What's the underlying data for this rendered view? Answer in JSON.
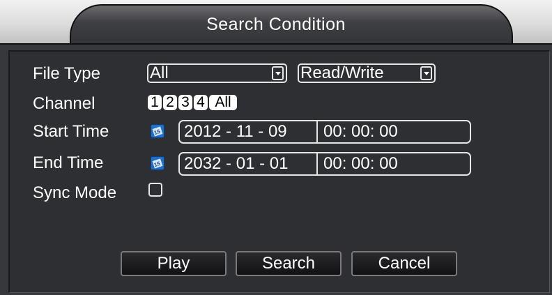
{
  "dialog": {
    "title": "Search Condition"
  },
  "form": {
    "file_type_label": "File Type",
    "file_type_value": "All",
    "access_value": "Read/Write",
    "channel_label": "Channel",
    "channels": [
      "1",
      "2",
      "3",
      "4",
      "All"
    ],
    "start_time_label": "Start Time",
    "start_date": "2012 - 11 - 09",
    "start_time": "00: 00: 00",
    "end_time_label": "End Time",
    "end_date": "2032 - 01 - 01",
    "end_time": "00: 00: 00",
    "sync_mode_label": "Sync Mode",
    "sync_mode_checked": false
  },
  "buttons": {
    "play": "Play",
    "search": "Search",
    "cancel": "Cancel"
  },
  "icons": {
    "calendar": "calendar-icon",
    "dropdown": "chevron-down-icon"
  },
  "colors": {
    "background": "#37383c",
    "panel": "#2e2f33",
    "border": "#e6e6e6",
    "calendar_accent": "#1f6fc9"
  }
}
